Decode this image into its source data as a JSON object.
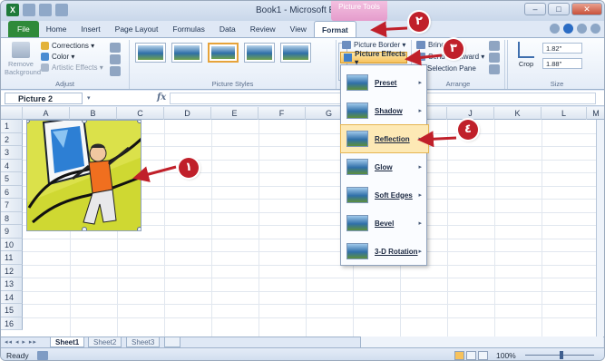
{
  "window": {
    "title": "Book1 - Microsoft Excel",
    "context_tab": "Picture Tools",
    "min": "–",
    "max": "□",
    "close": "✕"
  },
  "tabs": [
    "File",
    "Home",
    "Insert",
    "Page Layout",
    "Formulas",
    "Data",
    "Review",
    "View",
    "Format"
  ],
  "ribbon": {
    "adjust": {
      "remove_background": "Remove Background",
      "corrections": "Corrections ▾",
      "color": "Color ▾",
      "artistic_effects": "Artistic Effects ▾",
      "label": "Adjust"
    },
    "picture_styles": {
      "label": "Picture Styles",
      "thumb_count": 6
    },
    "picture_border": "Picture Border ▾",
    "picture_effects": "Picture Effects ▾",
    "bring_forward": "Bring",
    "send_backward": "Send Backward ▾",
    "selection_pane": "Selection Pane",
    "arrange_label": "Arrange",
    "crop": "Crop",
    "height": "1.82\"",
    "width": "1.88\"",
    "size_label": "Size"
  },
  "formula_bar": {
    "name_box": "Picture 2",
    "fx": "fx",
    "value": ""
  },
  "columns": [
    "A",
    "B",
    "C",
    "D",
    "E",
    "F",
    "G",
    "H",
    "I",
    "J",
    "K",
    "L",
    "M"
  ],
  "rows": [
    "1",
    "2",
    "3",
    "4",
    "5",
    "6",
    "7",
    "8",
    "9",
    "10",
    "11",
    "12",
    "13",
    "14",
    "15",
    "16"
  ],
  "picture_effects_menu": [
    {
      "label": "Preset",
      "chev": "▸"
    },
    {
      "label": "Shadow",
      "chev": "▸"
    },
    {
      "label": "Reflection",
      "chev": "▸"
    },
    {
      "label": "Glow",
      "chev": "▸"
    },
    {
      "label": "Soft Edges",
      "chev": "▸"
    },
    {
      "label": "Bevel",
      "chev": "▸"
    },
    {
      "label": "3-D Rotation",
      "chev": "▸"
    }
  ],
  "sheets": [
    "Sheet1",
    "Sheet2",
    "Sheet3"
  ],
  "nav_arrows": "◂◂ ◂ ▸ ▸▸",
  "status": {
    "ready": "Ready",
    "zoom": "100%"
  },
  "callouts": [
    "١",
    "٢",
    "٣",
    "٤"
  ],
  "colors": {
    "callout": "#c0202a",
    "file_tab": "#2f8a3a",
    "picture_tools": "#e59ccc",
    "highlight": "#fde9b5"
  }
}
